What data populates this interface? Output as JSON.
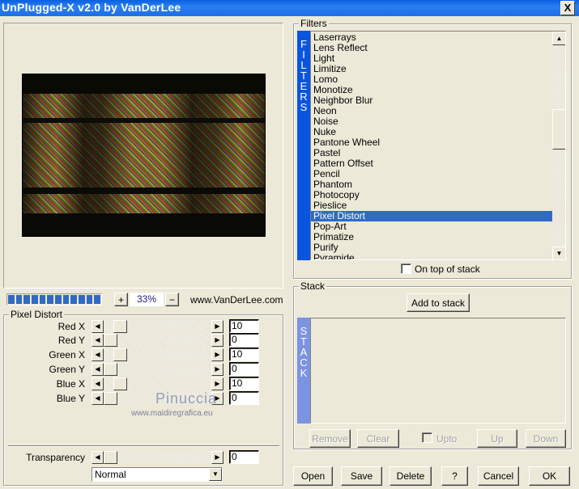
{
  "window": {
    "title": "UnPlugged-X v2.0 by VanDerLee",
    "close_label": "X"
  },
  "preview": {
    "progress_blocks": 12,
    "zoom_in_label": "+",
    "zoom_out_label": "−",
    "zoom": "33%",
    "website": "www.VanDerLee.com"
  },
  "params": {
    "group_label": "Pixel Distort",
    "slider_max_assumed": 100,
    "sliders": [
      {
        "label": "Red X",
        "value": "10"
      },
      {
        "label": "Red Y",
        "value": "0"
      },
      {
        "label": "Green X",
        "value": "10"
      },
      {
        "label": "Green Y",
        "value": "0"
      },
      {
        "label": "Blue X",
        "value": "10"
      },
      {
        "label": "Blue Y",
        "value": "0"
      }
    ],
    "transparency": {
      "label": "Transparency",
      "value": "0"
    },
    "blend_mode": "Normal"
  },
  "watermark": {
    "name": "Pinuccia",
    "url": "www.maidiregrafica.eu"
  },
  "filters": {
    "group_label": "Filters",
    "bar_label": "FILTERS",
    "items": [
      "Laserrays",
      "Lens Reflect",
      "Light",
      "Limitize",
      "Lomo",
      "Monotize",
      "Neighbor Blur",
      "Neon",
      "Noise",
      "Nuke",
      "Pantone Wheel",
      "Pastel",
      "Pattern Offset",
      "Pencil",
      "Phantom",
      "Photocopy",
      "Pieslice",
      "Pixel Distort",
      "Pop-Art",
      "Primatize",
      "Purify",
      "Pyramide"
    ],
    "selected": "Pixel Distort",
    "on_top_label": "On top of stack",
    "on_top_checked": false
  },
  "stack": {
    "group_label": "Stack",
    "bar_label": "STACK",
    "add_label": "Add to stack",
    "remove_label": "Remove",
    "clear_label": "Clear",
    "upto_label": "Upto",
    "up_label": "Up",
    "down_label": "Down"
  },
  "footer": {
    "open": "Open",
    "save": "Save",
    "delete": "Delete",
    "help": "?",
    "cancel": "Cancel",
    "ok": "OK"
  },
  "colors": {
    "titlebar": "#0a5fe0",
    "selection": "#316ac5",
    "filters_bar": "#0a55e0",
    "stack_bar": "#7b93e0",
    "face": "#ece9d8"
  }
}
